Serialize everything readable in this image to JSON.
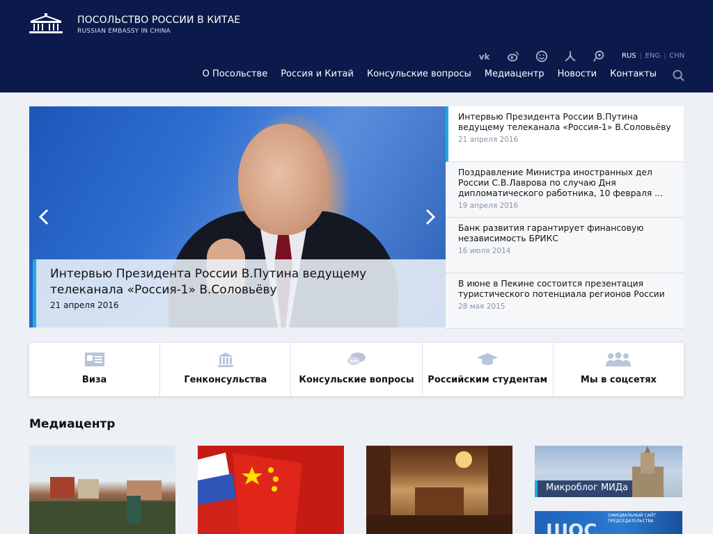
{
  "header": {
    "title": "ПОСОЛЬСТВО РОССИИ В КИТАЕ",
    "subtitle": "RUSSIAN EMBASSY IN CHINA",
    "languages": [
      "RUS",
      "ENG",
      "CHN"
    ],
    "nav": [
      "О Посольстве",
      "Россия и Китай",
      "Консульские вопросы",
      "Медиацентр",
      "Новости",
      "Контакты"
    ]
  },
  "slider": {
    "title": "Интервью Президента России В.Путина ведущему телеканала «Россия-1» В.Соловьёву",
    "date": "21 апреля 2016"
  },
  "news": [
    {
      "title": "Интервью Президента России В.Путина ведущему телеканала «Россия-1» В.Соловьёву",
      "date": "21 апреля 2016"
    },
    {
      "title": "Поздравление Министра иностранных дел России С.В.Лаврова по случаю Дня дипломатического работника, 10 февраля ...",
      "date": "19 апреля 2016"
    },
    {
      "title": "Банк развития гарантирует финансовую независимость БРИКС",
      "date": "16 июля 2014"
    },
    {
      "title": "В июне в Пекине состоится презентация туристического потенциала регионов России",
      "date": "28 мая 2015"
    }
  ],
  "quick_links": [
    "Виза",
    "Генконсульства",
    "Консульские вопросы",
    "Российским студентам",
    "Мы в соцсетях"
  ],
  "media": {
    "heading": "Медиацентр",
    "microblog_label": "Микроблог МИДа",
    "sco_big": "ШОС",
    "sco_text": "ОФИЦИАЛЬНЫЙ САЙТ ПРЕДСЕДАТЕЛЬСТВА"
  },
  "colors": {
    "header_bg": "#0b1a4b",
    "accent": "#23a7e8",
    "page_bg": "#edf0f5"
  }
}
